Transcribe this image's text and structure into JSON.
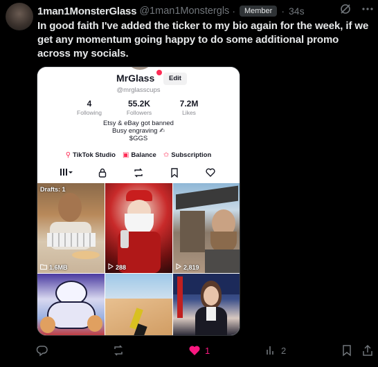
{
  "tweet": {
    "author_name": "1man1MonsterGlass",
    "handle": "@1man1Monstergls",
    "separator": "·",
    "badge": "Member",
    "time": "34s",
    "text": "In good faith I've added the ticker to my bio again for the week, if we get any momentum going happy to do some additional promo across my socials."
  },
  "screenshot": {
    "profile_name": "MrGlass",
    "edit_label": "Edit",
    "profile_handle": "@mrglasscups",
    "stats": [
      {
        "value": "4",
        "label": "Following"
      },
      {
        "value": "55.2K",
        "label": "Followers"
      },
      {
        "value": "7.2M",
        "label": "Likes"
      }
    ],
    "bio_lines": [
      "Etsy & eBay got banned",
      "Busy engraving ✍",
      "$GGS"
    ],
    "links": [
      {
        "icon": "tiktok-studio-icon",
        "label": "TikTok Studio"
      },
      {
        "icon": "balance-icon",
        "label": "Balance"
      },
      {
        "icon": "subscription-icon",
        "label": "Subscription"
      }
    ],
    "tabs": [
      {
        "icon": "grid-icon",
        "glyph": "⦀▾"
      },
      {
        "icon": "lock-icon",
        "glyph": "🔒"
      },
      {
        "icon": "repost-icon",
        "glyph": "⇄"
      },
      {
        "icon": "bookmark-icon",
        "glyph": "⚐"
      },
      {
        "icon": "heart-icon",
        "glyph": "♡"
      }
    ],
    "videos": [
      {
        "top_label": "Drafts: 1",
        "overlay": "1.6MB",
        "overlay_icon": "folder-icon"
      },
      {
        "top_label": "",
        "overlay": "288",
        "overlay_icon": "play-icon"
      },
      {
        "top_label": "",
        "overlay": "2,819",
        "overlay_icon": "play-icon"
      },
      {
        "top_label": "",
        "overlay": "",
        "overlay_icon": ""
      },
      {
        "top_label": "",
        "overlay": "",
        "overlay_icon": ""
      },
      {
        "top_label": "",
        "overlay": "",
        "overlay_icon": ""
      }
    ]
  },
  "actions": {
    "reply_count": "",
    "repost_count": "",
    "like_count": "1",
    "view_count": "2",
    "like_color": "#f91880"
  },
  "colors": {
    "background": "#000000",
    "text_primary": "#e7e9ea",
    "text_secondary": "#71767b",
    "tiktok_red": "#fe2c55"
  }
}
